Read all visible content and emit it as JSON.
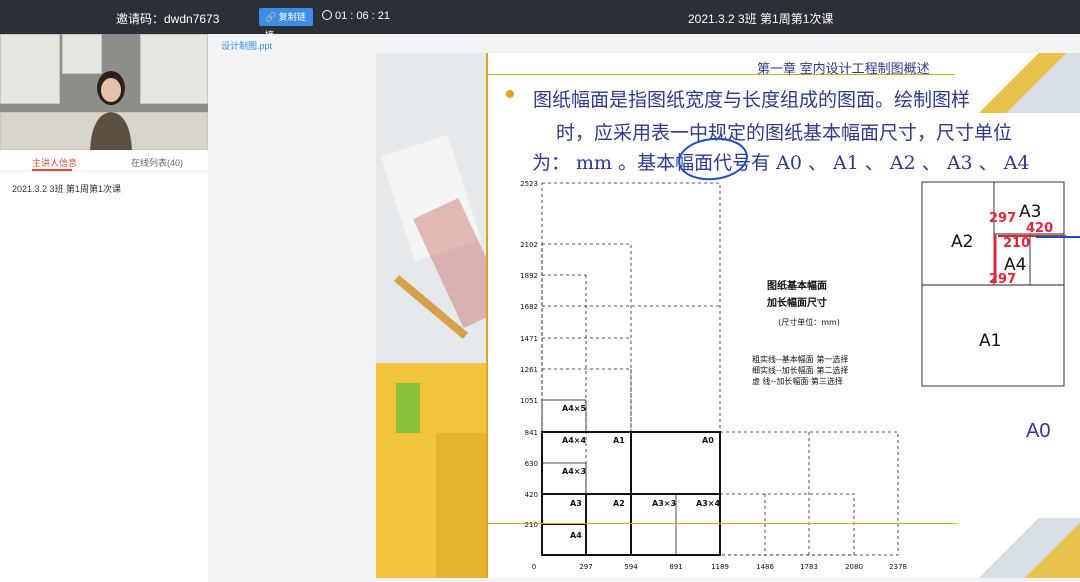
{
  "topbar": {
    "invite_code": "邀请码：dwdn7673",
    "copy_link_label": "复制链接",
    "timer": "01 : 06 : 21",
    "course_title": "2021.3.2 3班 第1周第1次课"
  },
  "left_panel": {
    "tabs": [
      {
        "label": "主讲人信息"
      },
      {
        "label": "在线列表(40)"
      }
    ],
    "session_item": "2021.3.2 3班 第1周第1次课"
  },
  "file": {
    "name": "设计制图.ppt"
  },
  "slide": {
    "chapter_title": "第一章  室内设计工程制图概述",
    "body_lines": [
      "图纸幅面是指图纸宽度与长度组成的图面。绘制图样",
      "时，应采用表一中规定的图纸基本幅面尺寸，尺寸单位",
      "为： mm 。基本幅面代号有 A0 、 A1 、 A2 、  A3 、 A4"
    ],
    "a0_label": "A0",
    "diagram_title_1": "图纸基本幅面",
    "diagram_title_2": "加长幅面尺寸",
    "diagram_unit": "(尺寸单位：mm)",
    "legend": [
      "粗实线--基本幅面    第一选择",
      "细实线--加长幅面    第二选择",
      "虚  线--加长幅面    第三选择"
    ],
    "y_ticks": [
      "2523",
      "2102",
      "1892",
      "1682",
      "1471",
      "1261",
      "1051",
      "841",
      "630",
      "420",
      "210"
    ],
    "x_ticks": [
      "0",
      "297",
      "594",
      "891",
      "1189",
      "1486",
      "1783",
      "2080",
      "2378"
    ],
    "boxes": [
      "A4×5",
      "A4×4",
      "A1",
      "A0",
      "A4×3",
      "A3",
      "A2",
      "A3×3",
      "A3×4",
      "A4"
    ],
    "right_diagram": {
      "labels": [
        "A2",
        "A3",
        "A4",
        "A1"
      ],
      "annotations": [
        "297",
        "420",
        "210",
        "297"
      ]
    }
  }
}
